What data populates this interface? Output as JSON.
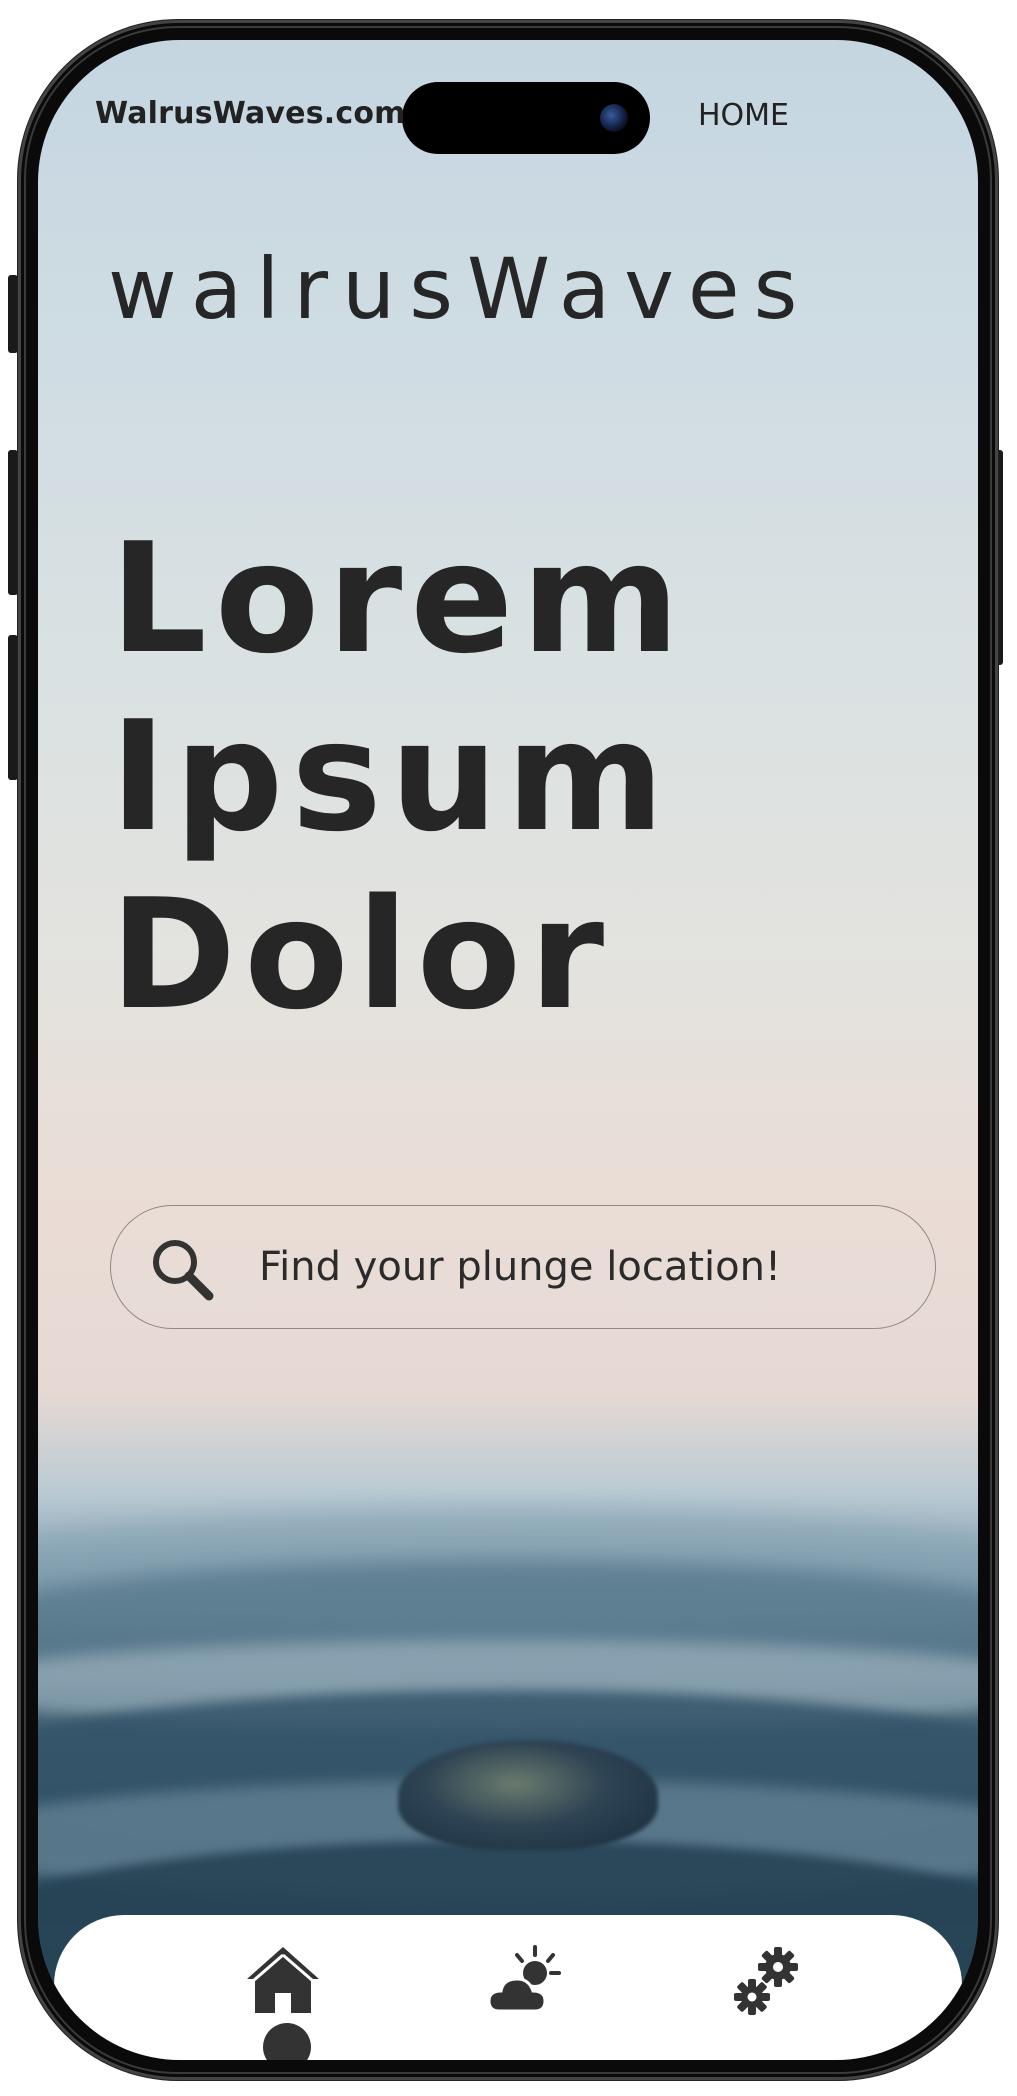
{
  "status_bar": {
    "site_url": "WalrusWaves.com",
    "home_link": "HOME"
  },
  "brand": {
    "logo_text": "walrusWaves"
  },
  "hero": {
    "lines": [
      "Lorem",
      "Ipsum",
      "Dolor"
    ]
  },
  "search": {
    "placeholder": "Find your plunge location!",
    "icon": "search-icon"
  },
  "bottom_nav": {
    "items": [
      {
        "icon": "home-icon",
        "active": true
      },
      {
        "icon": "weather-icon",
        "active": false
      },
      {
        "icon": "settings-icon",
        "active": false
      }
    ]
  },
  "colors": {
    "text_dark": "#262626",
    "sky_top": "#c5d6e1",
    "sky_mid": "#e3e3df",
    "sky_warm": "#eadcd5",
    "ocean_dark": "#2f4e61",
    "nav_icon": "#333333",
    "nav_bg": "#ffffff"
  }
}
